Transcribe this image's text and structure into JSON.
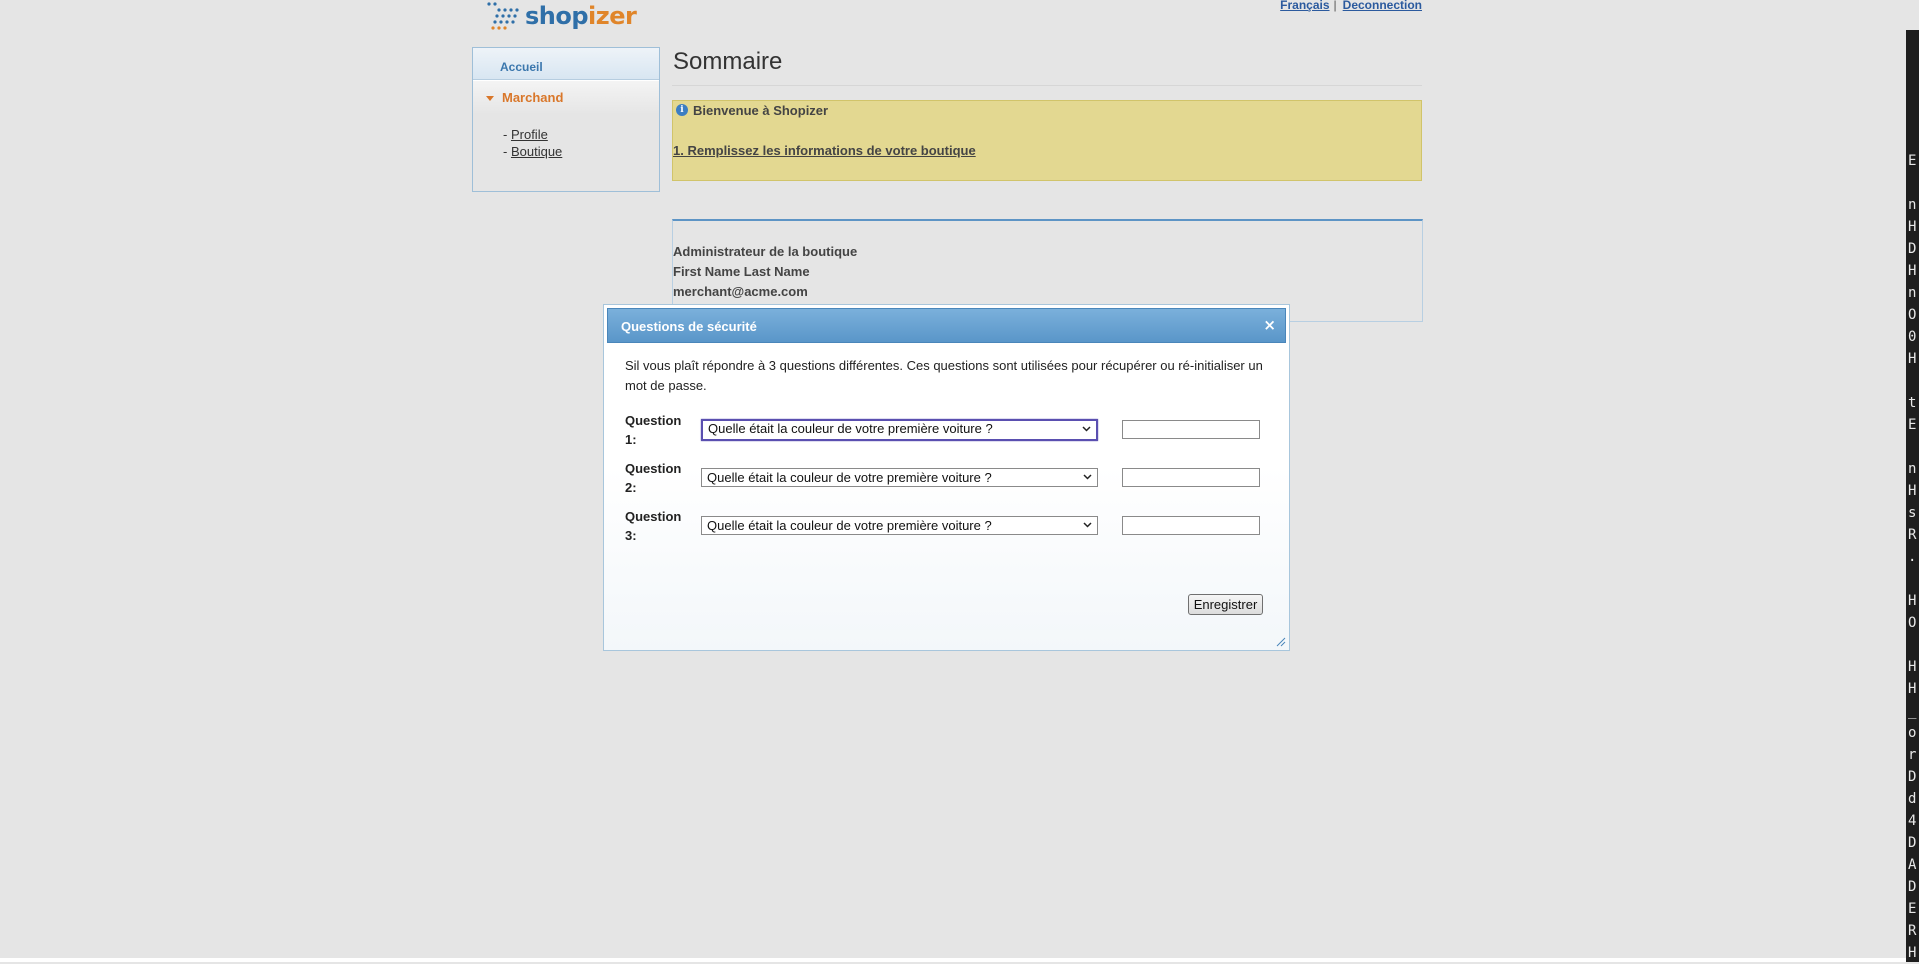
{
  "header": {
    "logo_prefix": "shop",
    "logo_suffix": "izer",
    "lang_link": "Français",
    "separator": "|",
    "logout_link": "Deconnection"
  },
  "sidebar": {
    "home": "Accueil",
    "section": "Marchand",
    "items": [
      {
        "prefix": "-",
        "label": "Profile"
      },
      {
        "prefix": "-",
        "label": "Boutique"
      }
    ]
  },
  "main": {
    "title": "Sommaire",
    "welcome_title": "Bienvenue à Shopizer",
    "welcome_step": "1. Remplissez les informations de votre boutique",
    "admin_heading": "Administrateur de la boutique",
    "admin_name": "First Name Last Name",
    "admin_email": "merchant@acme.com"
  },
  "dialog": {
    "title": "Questions de sécurité",
    "close": "×",
    "intro": "Sil vous plaît répondre à 3 questions différentes. Ces questions sont utilisées pour récupérer ou ré-initialiser un mot de passe.",
    "questions": [
      {
        "label_line1": "Question",
        "label_line2": "1:",
        "selected": "Quelle était la couleur de votre première voiture ?",
        "answer": ""
      },
      {
        "label_line1": "Question",
        "label_line2": "2:",
        "selected": "Quelle était la couleur de votre première voiture ?",
        "answer": ""
      },
      {
        "label_line1": "Question",
        "label_line2": "3:",
        "selected": "Quelle était la couleur de votre première voiture ?",
        "answer": ""
      }
    ],
    "save_label": "Enregistrer"
  },
  "terminal_chars": [
    "E",
    "",
    "n",
    "H",
    "D",
    "H",
    "n",
    "O",
    "0",
    "H",
    "",
    "t",
    "E",
    "",
    "n",
    "H",
    "s",
    "R",
    ".",
    "",
    "H",
    "O",
    "",
    "H",
    "H",
    "_",
    "o",
    "r",
    "D",
    "d",
    "4",
    "D",
    "A",
    "D",
    "E",
    "R",
    "H"
  ],
  "colors": {
    "accent_blue": "#5a96c9",
    "brand_orange": "#e0852a",
    "welcome_bg": "#e3d891"
  }
}
